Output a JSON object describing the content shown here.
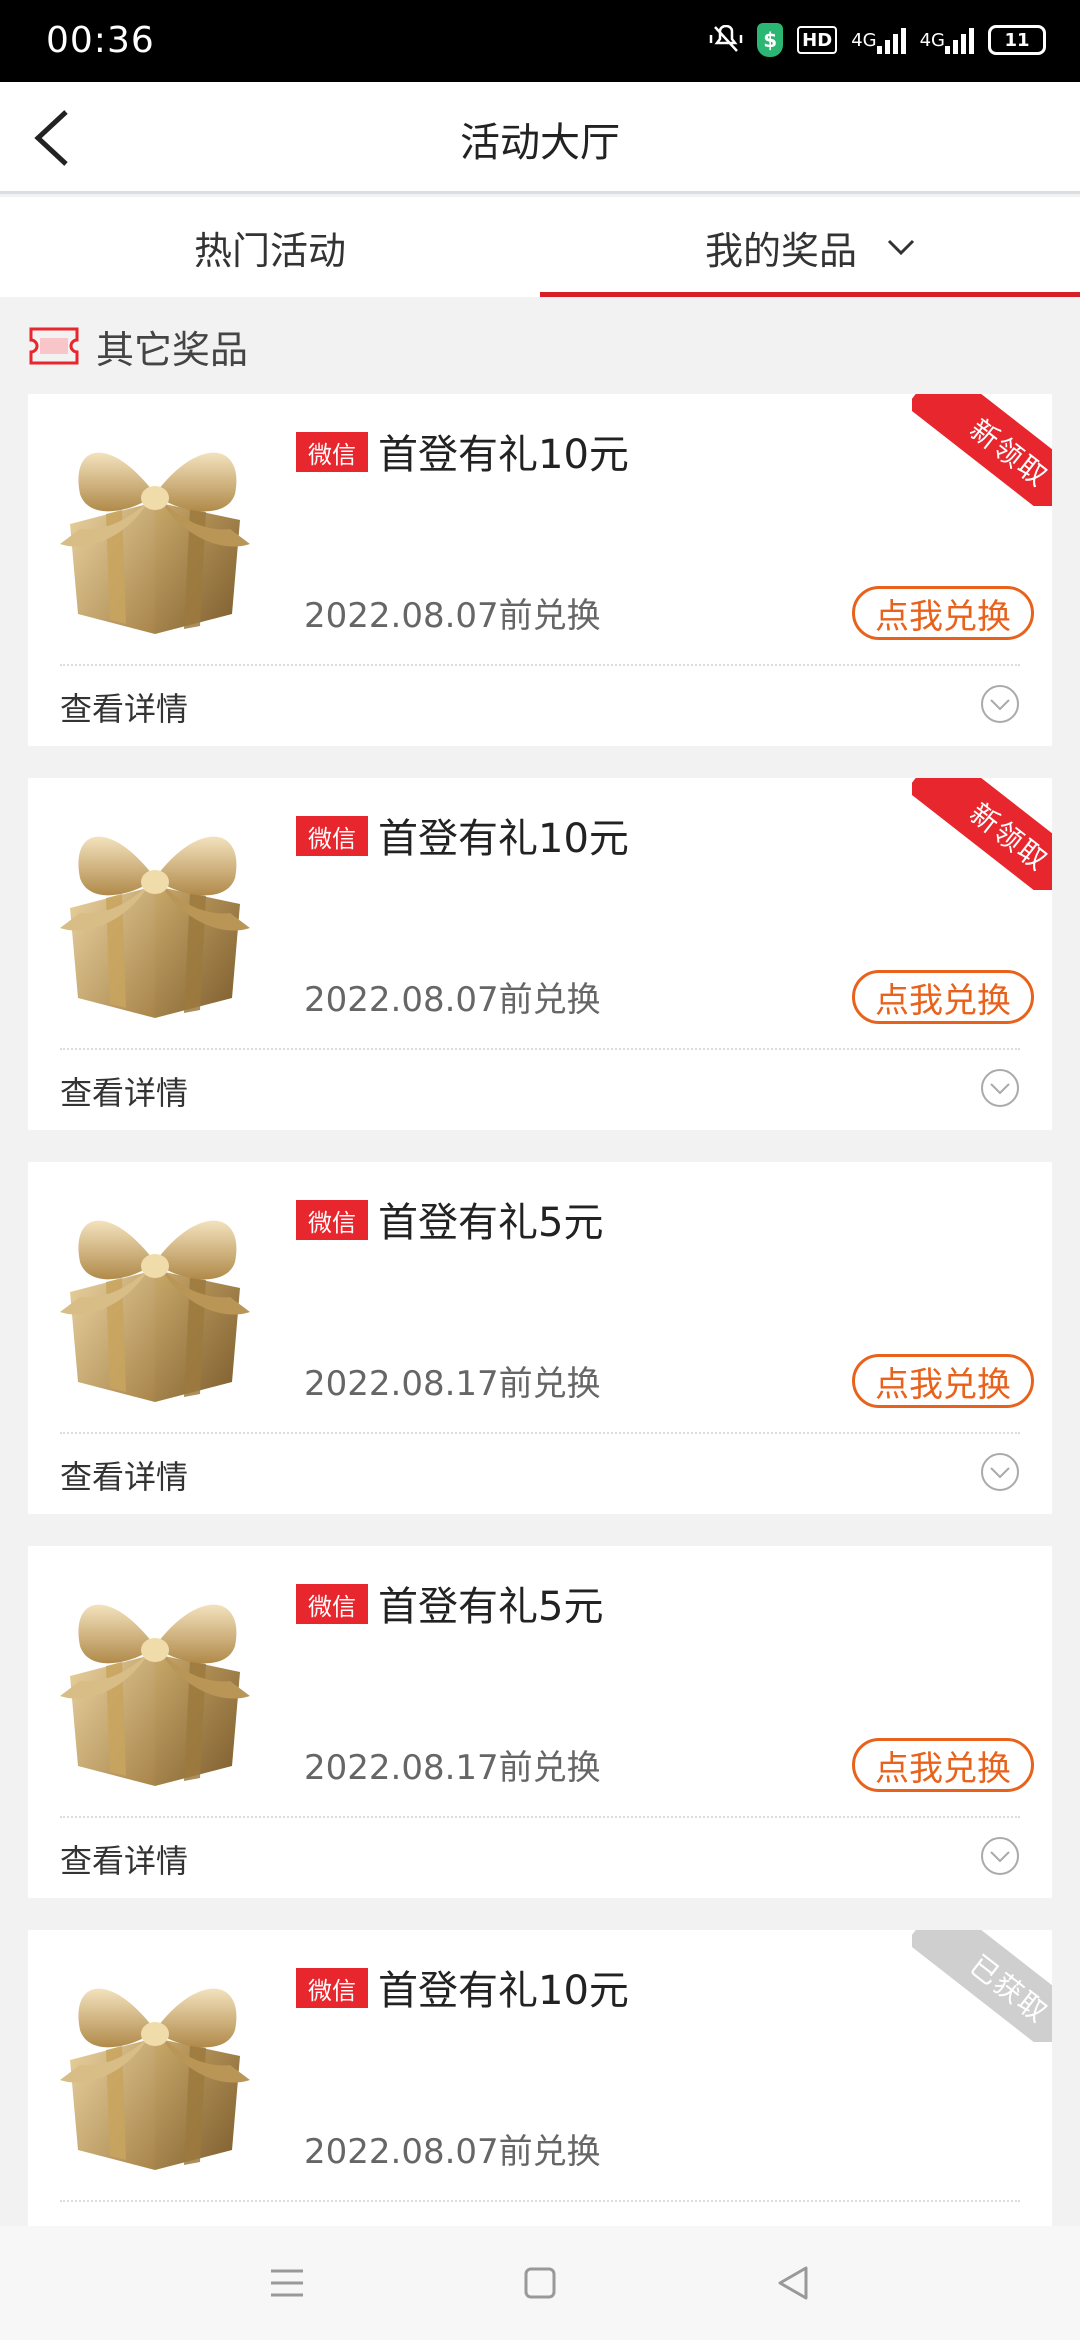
{
  "status_bar": {
    "time": "00:36",
    "icons": [
      "mute-vibrate-icon",
      "shield-icon",
      "hd-icon",
      "signal-4g-icon",
      "signal-4g-icon",
      "battery-icon"
    ],
    "hd": "HD",
    "signal1": "4G",
    "signal2": "4G",
    "battery": "11"
  },
  "header": {
    "title": "活动大厅",
    "back_icon": "back-arrow-icon"
  },
  "tabs": [
    {
      "label": "热门活动",
      "active": false
    },
    {
      "label": "我的奖品",
      "active": true,
      "icon": "chevron-down-icon"
    }
  ],
  "section": {
    "title": "其它奖品",
    "icon": "ticket-icon",
    "accent": "#e8262d"
  },
  "colors": {
    "brand_red": "#e8262d",
    "button_orange": "#e8621c",
    "ribbon_gray": "#cfcfcf"
  },
  "cards": [
    {
      "tag": "微信",
      "title": "首登有礼10元",
      "date": "2022.08.07前兑换",
      "button": "点我兑换",
      "details": "查看详情",
      "ribbon": "新领取",
      "ribbon_state": "new"
    },
    {
      "tag": "微信",
      "title": "首登有礼10元",
      "date": "2022.08.07前兑换",
      "button": "点我兑换",
      "details": "查看详情",
      "ribbon": "新领取",
      "ribbon_state": "new"
    },
    {
      "tag": "微信",
      "title": "首登有礼5元",
      "date": "2022.08.17前兑换",
      "button": "点我兑换",
      "details": "查看详情",
      "ribbon": "",
      "ribbon_state": "none"
    },
    {
      "tag": "微信",
      "title": "首登有礼5元",
      "date": "2022.08.17前兑换",
      "button": "点我兑换",
      "details": "查看详情",
      "ribbon": "",
      "ribbon_state": "none"
    },
    {
      "tag": "微信",
      "title": "首登有礼10元",
      "date": "2022.08.07前兑换",
      "button": "",
      "details": "",
      "ribbon": "已获取",
      "ribbon_state": "done"
    }
  ],
  "nav_bar": {
    "icons": [
      "menu-icon",
      "home-square-icon",
      "back-triangle-icon"
    ]
  }
}
